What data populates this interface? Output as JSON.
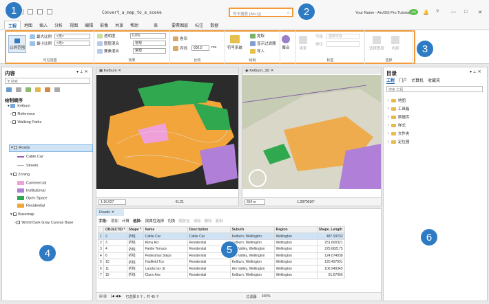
{
  "titlebar": {
    "project": "Convert_a_map_to_a_scene",
    "search_placeholder": "命令搜索 (Alt+Q)",
    "user": "Your Name - ArcGIS Pro Tutorials",
    "user_initials": "YN",
    "help": "?",
    "minimize": "—",
    "maximize": "□",
    "close": "✕"
  },
  "tabs": [
    "工程",
    "地图",
    "插入",
    "分析",
    "视图",
    "编辑",
    "影像",
    "共享",
    "帮助",
    "表",
    "要素图层",
    "标注",
    "数据"
  ],
  "ribbon": {
    "scale_btn": "比例范围",
    "max_scale": "最大比例",
    "min_scale": "最小比例",
    "none1": "<无>",
    "none2": "<无>",
    "group_range": "可见范围",
    "transparency": "透明度",
    "transparency_val": "0.0%",
    "layer_blend": "图层混合",
    "blend_val": "常规",
    "feature_blend": "要素混合",
    "feature_blend_val": "常规",
    "group_effects": "效果",
    "swipe": "卷帘",
    "flicker": "闪烁",
    "flicker_val": "600.0",
    "flicker_unit": "ms",
    "group_compare": "比较",
    "symbology": "符号系统",
    "extract": "提取",
    "display_filter": "显示过滤器",
    "import": "导入",
    "group_drawing": "绘制",
    "aggregate": "聚合",
    "group_agg": "聚合",
    "category": "类型",
    "field": "字段",
    "field_val": "选择字段",
    "unit": "单位",
    "group_label": "标签",
    "selectable": "选择图层",
    "inclusion": "内部",
    "group_select": "选择"
  },
  "badges": [
    "1",
    "2",
    "3",
    "4",
    "5",
    "6"
  ],
  "contents": {
    "title": "内容",
    "search": "搜索",
    "draw_order": "绘制顺序",
    "items": [
      "Kelburn",
      "Reference",
      "Walking Paths",
      "Roads",
      "Cable Car",
      "Streets",
      "Zoning",
      "Commercial",
      "Institutional",
      "Open Space",
      "Residential",
      "Basemap",
      "World Dark Gray Canvas Base"
    ]
  },
  "map_tabs": {
    "map2d": "Kelburn",
    "map3d": "Kelburn_3D"
  },
  "map_status": {
    "scale2d": "1:16,027",
    "coord2d": "41.21",
    "scale3d": "654 m",
    "coord3d": "1.2870036°",
    "zoom": "100%"
  },
  "table": {
    "tab": "Roads",
    "toolbar": [
      "字段:",
      "添加",
      "计算",
      "选择:",
      "按属性选择",
      "切换",
      "缩放至",
      "清除",
      "删除",
      "复制"
    ],
    "columns": [
      "OBJECTID *",
      "Shape *",
      "Name",
      "Description",
      "Suburb",
      "Region",
      "Shape_Length"
    ],
    "rows": [
      [
        "1",
        "2",
        "折线",
        "Cable Car",
        "Cable Car",
        "Kelburn, Wellington",
        "Wellington",
        "487.93232"
      ],
      [
        "2",
        "3",
        "折线",
        "Rimu Rd",
        "Residential",
        "Kelburn, Wellington",
        "Wellington",
        "251.600321"
      ],
      [
        "3",
        "4",
        "折线",
        "Fairlie Terrace",
        "Residential",
        "Aro Valley, Wellington",
        "Wellington",
        "225.662175"
      ],
      [
        "4",
        "6",
        "折线",
        "Pedestrian Steps",
        "Residential",
        "Aro Valley, Wellington",
        "Wellington",
        "124.074038"
      ],
      [
        "5",
        "10",
        "折线",
        "Hadfield Tce",
        "Residential",
        "Kelburn, Wellington",
        "Wellington",
        "120.497931"
      ],
      [
        "6",
        "11",
        "折线",
        "Landcross St",
        "Residential",
        "Aro Valley, Wellington",
        "Wellington",
        "106.949345"
      ],
      [
        "7",
        "15",
        "折线",
        "Clunv Ave",
        "Residential",
        "Kelburn, Wellington",
        "Wellington",
        "61.67066"
      ]
    ],
    "status": "已选择 0 个，共 45 个",
    "filter": "过滤器:",
    "zoom": "100%"
  },
  "catalog": {
    "title": "目录",
    "tabs": [
      "工程",
      "门户",
      "计算机",
      "收藏夹"
    ],
    "search": "搜索 工程",
    "items": [
      "地图",
      "工具箱",
      "数据库",
      "样式",
      "文件夹",
      "定位器"
    ]
  },
  "colors": {
    "accent": "#1d62a8",
    "orange": "#f29b38",
    "badge": "#2e7bc4",
    "residential": "#f2a53a",
    "openspace": "#2fa84f",
    "institutional": "#b07fd8",
    "commercial": "#f0a0d8"
  }
}
